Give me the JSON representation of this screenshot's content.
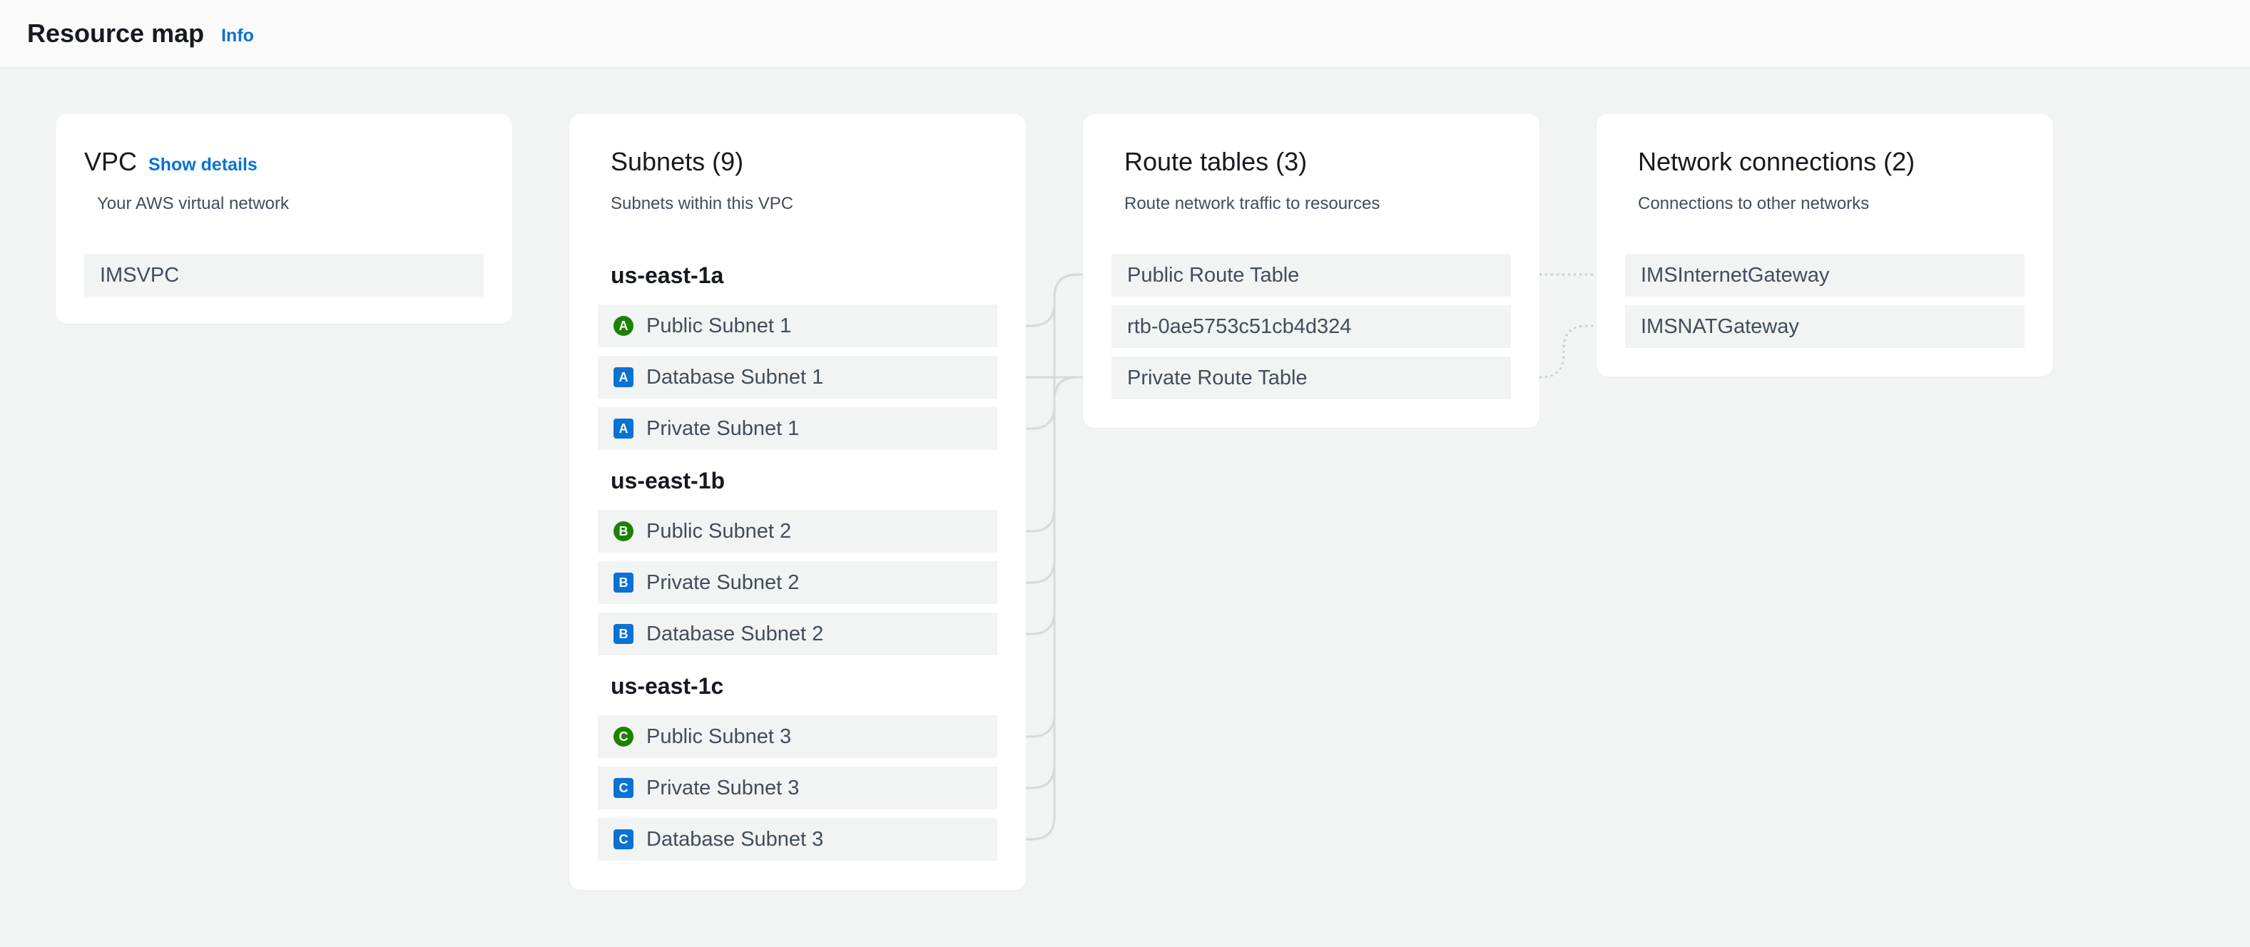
{
  "header": {
    "title": "Resource map",
    "info_link": "Info"
  },
  "vpc": {
    "title": "VPC",
    "details_link": "Show details",
    "subtitle": "Your AWS virtual network",
    "name": "IMSVPC"
  },
  "subnets": {
    "title": "Subnets (9)",
    "subtitle": "Subnets within this VPC",
    "zones": [
      {
        "name": "us-east-1a",
        "items": [
          {
            "badge": "A",
            "type": "public",
            "label": "Public Subnet 1"
          },
          {
            "badge": "A",
            "type": "private",
            "label": "Database Subnet 1"
          },
          {
            "badge": "A",
            "type": "private",
            "label": "Private Subnet 1"
          }
        ]
      },
      {
        "name": "us-east-1b",
        "items": [
          {
            "badge": "B",
            "type": "public",
            "label": "Public Subnet 2"
          },
          {
            "badge": "B",
            "type": "private",
            "label": "Private Subnet 2"
          },
          {
            "badge": "B",
            "type": "private",
            "label": "Database Subnet 2"
          }
        ]
      },
      {
        "name": "us-east-1c",
        "items": [
          {
            "badge": "C",
            "type": "public",
            "label": "Public Subnet 3"
          },
          {
            "badge": "C",
            "type": "private",
            "label": "Private Subnet 3"
          },
          {
            "badge": "C",
            "type": "private",
            "label": "Database Subnet 3"
          }
        ]
      }
    ]
  },
  "route_tables": {
    "title": "Route tables (3)",
    "subtitle": "Route network traffic to resources",
    "items": [
      "Public Route Table",
      "rtb-0ae5753c51cb4d324",
      "Private Route Table"
    ]
  },
  "network_connections": {
    "title": "Network connections (2)",
    "subtitle": "Connections to other networks",
    "items": [
      "IMSInternetGateway",
      "IMSNATGateway"
    ]
  },
  "colors": {
    "public_badge": "#1d8102",
    "private_badge": "#0972d3",
    "link": "#0972d3",
    "connector": "#d5dbdb"
  }
}
